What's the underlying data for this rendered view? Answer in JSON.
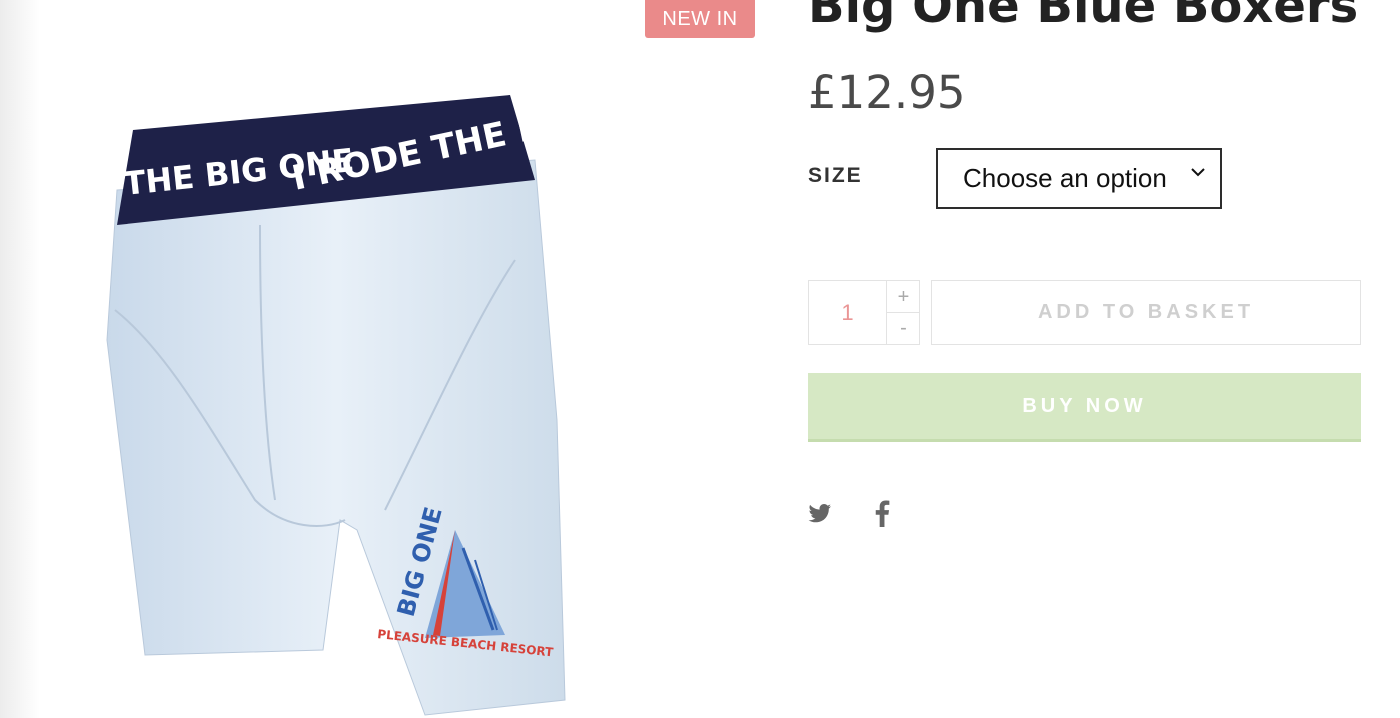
{
  "product": {
    "badge": "NEW IN",
    "title": "Big One Blue Boxers",
    "price": "£12.95",
    "image": {
      "waistband_text_left": "THE BIG ONE",
      "waistband_text_right": "I RODE THE BIG",
      "logo_text_main": "BIG ONE",
      "logo_text_sub": "PLEASURE BEACH RESORT"
    }
  },
  "options": {
    "size_label": "SIZE",
    "size_selected": "Choose an option"
  },
  "purchase": {
    "quantity": "1",
    "plus": "+",
    "minus": "-",
    "add_to_basket": "ADD TO BASKET",
    "buy_now": "BUY NOW"
  },
  "share": {
    "icons": [
      "twitter-icon",
      "facebook-icon"
    ]
  },
  "colors": {
    "badge": "#ea8a8a",
    "buy_now": "#d6e8c4",
    "waistband": "#1e2148",
    "boxer_fabric": "#dde9f5",
    "logo_red": "#d6423a",
    "logo_blue": "#2f5fae"
  }
}
